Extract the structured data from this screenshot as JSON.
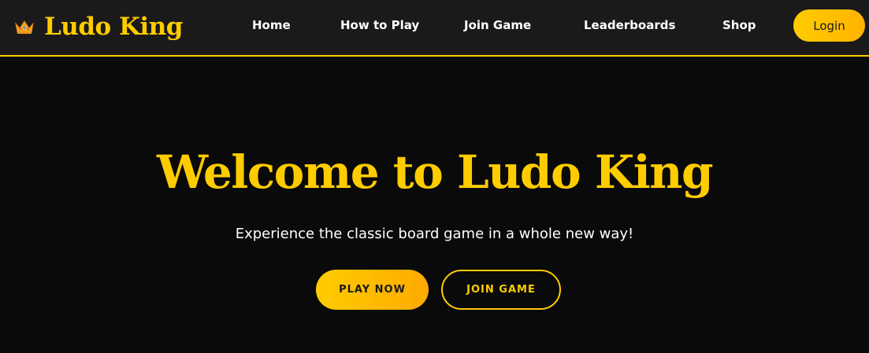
{
  "brand": {
    "icon": "crown-icon",
    "name": "Ludo King"
  },
  "nav": {
    "items": [
      {
        "label": "Home"
      },
      {
        "label": "How to Play"
      },
      {
        "label": "Join Game"
      },
      {
        "label": "Leaderboards"
      },
      {
        "label": "Shop"
      }
    ],
    "login_label": "Login"
  },
  "hero": {
    "title": "Welcome to Ludo King",
    "subtitle": "Experience the classic board game in a whole new way!",
    "primary_cta": "PLAY NOW",
    "secondary_cta": "JOIN GAME"
  },
  "colors": {
    "accent": "#ffcc00",
    "nav_background": "#1a1a1a",
    "page_background": "#0a0a0a",
    "text": "#ffffff"
  }
}
